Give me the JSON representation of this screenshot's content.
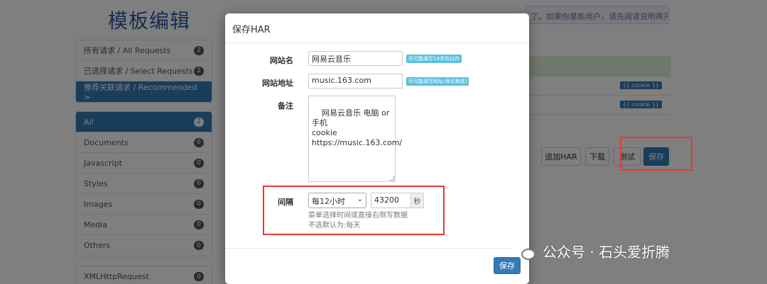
{
  "page": {
    "title": "模板编辑",
    "notice": "了。如果你是新用户，请先阅读说明再开始使用测试。"
  },
  "sidebar": {
    "group1": [
      {
        "label": "所有请求 / All Requests",
        "count": "2"
      },
      {
        "label": "已选择请求 / Select Requests",
        "count": "2"
      },
      {
        "label": "推荐关联请求 / Recommended >",
        "count": ""
      }
    ],
    "group2": [
      {
        "label": "All",
        "count": "2"
      },
      {
        "label": "Documents",
        "count": "0"
      },
      {
        "label": "Javascript",
        "count": "0"
      },
      {
        "label": "Styles",
        "count": "0"
      },
      {
        "label": "Images",
        "count": "0"
      },
      {
        "label": "Media",
        "count": "0"
      },
      {
        "label": "Others",
        "count": "0"
      }
    ],
    "group3": [
      {
        "label": "XMLHttpRequest",
        "count": "0"
      }
    ]
  },
  "background_table": {
    "rows": [
      {
        "tag": "{{ cookie }}"
      },
      {
        "tag": "{{ cookie }}"
      }
    ]
  },
  "toolbar": {
    "append_har": "追加HAR",
    "download": "下载",
    "test": "测试",
    "save": "保存"
  },
  "modal": {
    "title": "保存HAR",
    "site_name_label": "网站名",
    "site_name_value": "网易云音乐",
    "site_name_hint": "尽可能填写14字符以内",
    "site_url_label": "网站地址",
    "site_url_value": "music.163.com",
    "site_url_hint": "尽可能填写网址(保证美观)",
    "note_label": "备注",
    "note_value": "网易云音乐 电脑 or 手机\ncookie\nhttps://music.163.com/",
    "interval_label": "间隔",
    "interval_select": "每12小时",
    "interval_seconds": "43200",
    "interval_unit": "秒",
    "help_line1": "菜单选择时间或直接右侧写数据",
    "help_line2": "不选默认为:每天",
    "save_button": "保存"
  },
  "watermark": {
    "text": "公众号 · 石头爱折腾"
  },
  "colors": {
    "primary": "#337ab7",
    "highlight": "#e53935",
    "info": "#5bc0de"
  }
}
